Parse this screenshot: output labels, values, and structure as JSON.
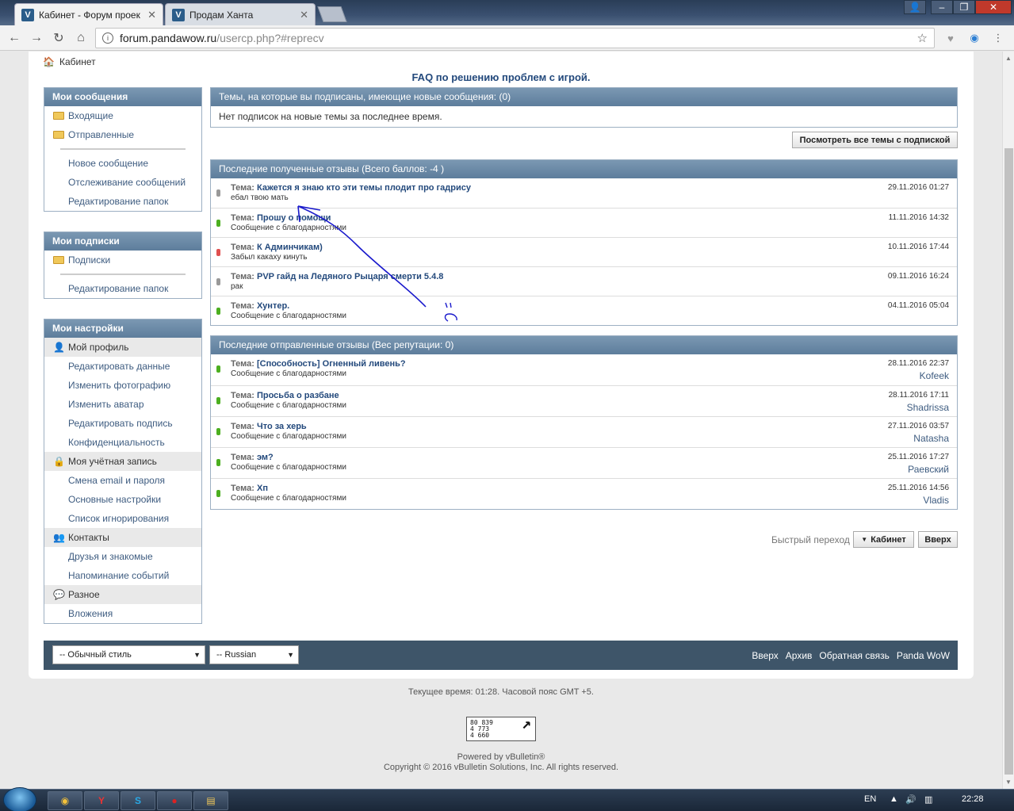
{
  "browser": {
    "tabs": [
      {
        "title": "Кабинет - Форум проек",
        "favicon": "V"
      },
      {
        "title": "Продам Ханта",
        "favicon": "V"
      }
    ],
    "url_host": "forum.pandawow.ru",
    "url_path": "/usercp.php?#reprecv"
  },
  "breadcrumb": "Кабинет",
  "faq_link": "FAQ по решению проблем с игрой.",
  "sidebar": {
    "messages": {
      "title": "Мои сообщения",
      "folders": [
        "Входящие",
        "Отправленные"
      ],
      "items": [
        "Новое сообщение",
        "Отслеживание сообщений",
        "Редактирование папок"
      ]
    },
    "subscriptions": {
      "title": "Мои подписки",
      "folders": [
        "Подписки"
      ],
      "items": [
        "Редактирование папок"
      ]
    },
    "settings": {
      "title": "Мои настройки",
      "profile": "Мой профиль",
      "profile_items": [
        "Редактировать данные",
        "Изменить фотографию",
        "Изменить аватар",
        "Редактировать подпись",
        "Конфиденциальность"
      ],
      "account": "Моя учётная запись",
      "account_items": [
        "Смена email и пароля",
        "Основные настройки",
        "Список игнорирования"
      ],
      "contacts": "Контакты",
      "contacts_items": [
        "Друзья и знакомые",
        "Напоминание событий"
      ],
      "misc": "Разное",
      "misc_items": [
        "Вложения"
      ]
    }
  },
  "subscribed": {
    "title": "Темы, на которые вы подписаны, имеющие новые сообщения: (0)",
    "empty": "Нет подписок на новые темы за последнее время.",
    "view_all_button": "Посмотреть все темы с подпиской"
  },
  "received": {
    "title": "Последние полученные отзывы (Всего баллов: -4 )",
    "topic_prefix": "Тема:",
    "rows": [
      {
        "topic": "Кажется я знаю кто эти темы плодит про гадрису",
        "comment": "ебал твою мать",
        "date": "29.11.2016 01:27",
        "color": "#999999"
      },
      {
        "topic": "Прошу о помощи",
        "comment": "Сообщение с благодарностями",
        "date": "11.11.2016 14:32",
        "color": "#4caf20"
      },
      {
        "topic": "К Админчикам)",
        "comment": "Забыл какаху кинуть",
        "date": "10.11.2016 17:44",
        "color": "#e05050"
      },
      {
        "topic": "PVP гайд на Ледяного Рыцаря смерти 5.4.8",
        "comment": "рак",
        "date": "09.11.2016 16:24",
        "color": "#999999"
      },
      {
        "topic": "Хунтер.",
        "comment": "Сообщение с благодарностями",
        "date": "04.11.2016 05:04",
        "color": "#4caf20"
      }
    ]
  },
  "sent": {
    "title": "Последние отправленные отзывы (Вес репутации: 0)",
    "rows": [
      {
        "topic": "[Способность] Огненный ливень?",
        "comment": "Сообщение с благодарностями",
        "date": "28.11.2016 22:37",
        "user": "Kofeek"
      },
      {
        "topic": "Просьба о разбане",
        "comment": "Сообщение с благодарностями",
        "date": "28.11.2016 17:11",
        "user": "Shadrissa"
      },
      {
        "topic": "Что за херь",
        "comment": "Сообщение с благодарностями",
        "date": "27.11.2016 03:57",
        "user": "Natasha"
      },
      {
        "topic": "эм?",
        "comment": "Сообщение с благодарностями",
        "date": "25.11.2016 17:27",
        "user": "Раевский"
      },
      {
        "topic": "Хп",
        "comment": "Сообщение с благодарностями",
        "date": "25.11.2016 14:56",
        "user": "Vladis"
      }
    ]
  },
  "quick_nav": {
    "label": "Быстрый переход",
    "cabinet": "Кабинет",
    "top": "Вверх"
  },
  "footer": {
    "style_select": "-- Обычный стиль",
    "lang_select": "-- Russian",
    "links": [
      "Вверх",
      "Архив",
      "Обратная связь",
      "Panda WoW"
    ]
  },
  "time_info": "Текущее время: 01:28. Часовой пояс GMT +5.",
  "counter_lines": [
    "80 839",
    "4 773",
    "4 660"
  ],
  "powered": "Powered by vBulletin®",
  "copyright": "Copyright © 2016 vBulletin Solutions, Inc. All rights reserved.",
  "taskbar": {
    "lang": "EN",
    "clock": "22:28"
  }
}
